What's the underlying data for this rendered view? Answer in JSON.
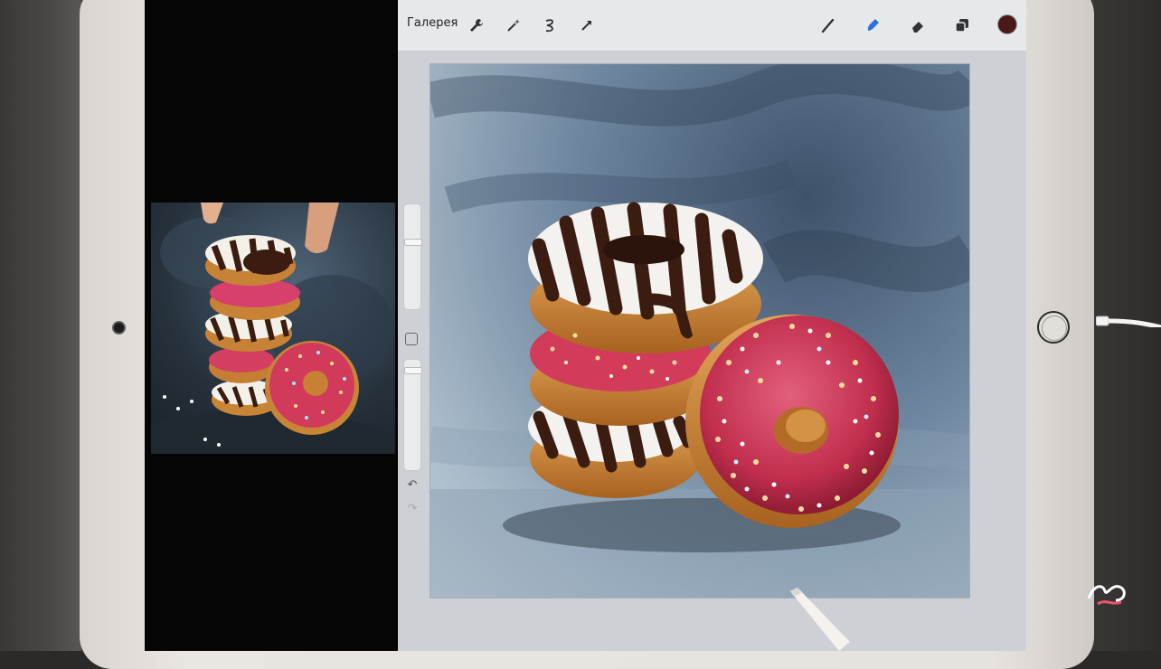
{
  "toolbar": {
    "gallery_label": "Галерея",
    "tools_left": [
      "wrench-icon",
      "magic-wand-icon",
      "selection-icon",
      "transform-arrow-icon"
    ],
    "tools_right": [
      "brush-icon",
      "smudge-icon",
      "eraser-icon",
      "layers-icon"
    ],
    "active_tool": "smudge-icon",
    "current_color": "#4a1a18",
    "accent_color": "#2f6fe0"
  },
  "sidebar": {
    "undo_glyph": "↶",
    "redo_glyph": "↷"
  },
  "colors": {
    "canvas_background": "#6f87a0",
    "chocolate": "#4a2414",
    "pink_glaze": "#d23b5a",
    "dough": "#d18a3a"
  }
}
